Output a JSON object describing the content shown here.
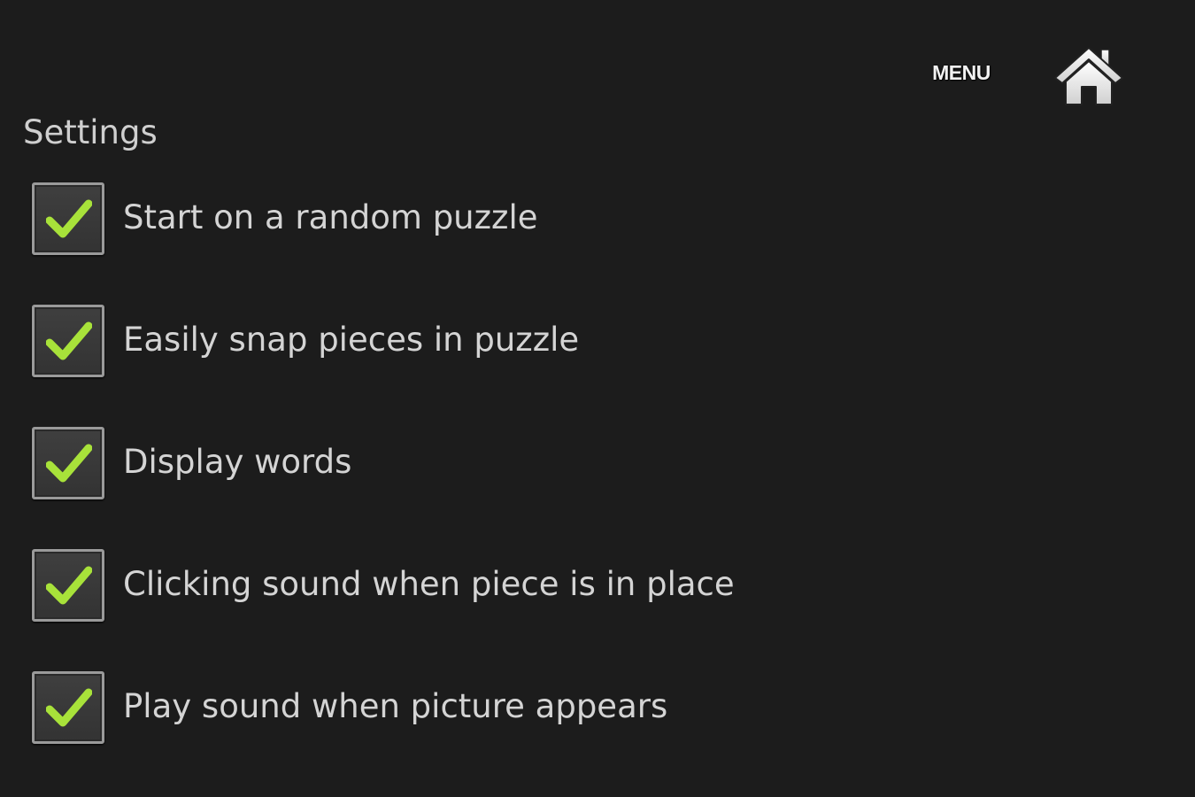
{
  "header": {
    "menu_label": "MENU",
    "home_icon": "home-icon"
  },
  "settings": {
    "title": "Settings",
    "items": [
      {
        "label": "Start on a random puzzle",
        "checked": true
      },
      {
        "label": "Easily snap pieces in puzzle",
        "checked": true
      },
      {
        "label": "Display words",
        "checked": true
      },
      {
        "label": "Clicking sound when piece is in place",
        "checked": true
      },
      {
        "label": "Play sound when picture appears",
        "checked": true
      }
    ]
  },
  "colors": {
    "background": "#1c1c1c",
    "checkmark": "#a8e23a",
    "text": "#d4d4d4"
  }
}
